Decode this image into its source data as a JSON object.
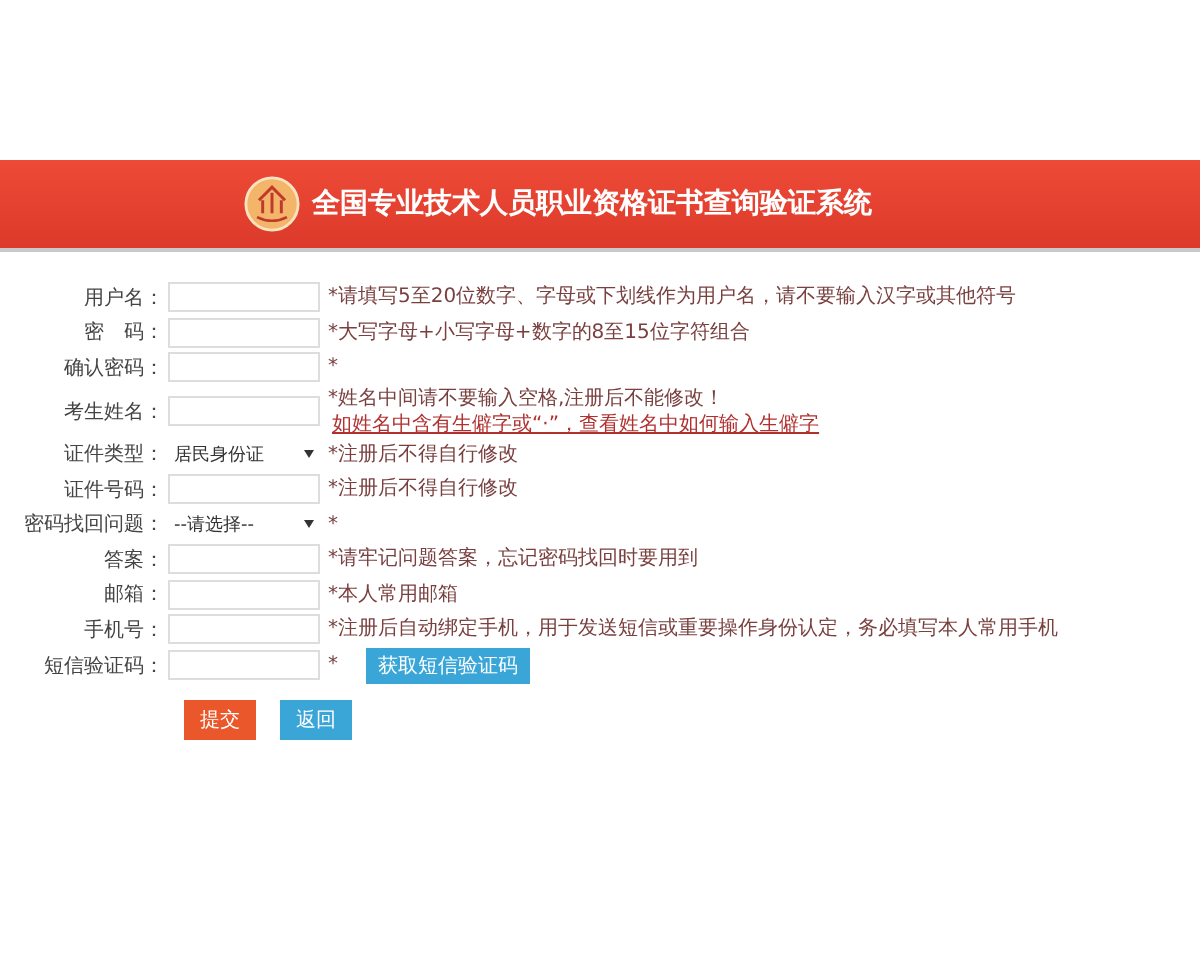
{
  "header": {
    "title": "全国专业技术人员职业资格证书查询验证系统"
  },
  "form": {
    "rows": [
      {
        "label": "用户名：",
        "kind": "input",
        "hint": "*请填写5至20位数字、字母或下划线作为用户名，请不要输入汉字或其他符号"
      },
      {
        "label": "密　码：",
        "kind": "input",
        "hint": "*大写字母+小写字母+数字的8至15位字符组合"
      },
      {
        "label": "确认密码：",
        "kind": "input",
        "hint": "*"
      },
      {
        "label": "考生姓名：",
        "kind": "input",
        "hint": "*姓名中间请不要输入空格,注册后不能修改！",
        "link": "如姓名中含有生僻字或“·”，查看姓名中如何输入生僻字"
      },
      {
        "label": "证件类型：",
        "kind": "select",
        "value": "居民身份证",
        "hint": "*注册后不得自行修改"
      },
      {
        "label": "证件号码：",
        "kind": "input",
        "hint": "*注册后不得自行修改"
      },
      {
        "label": "密码找回问题：",
        "kind": "select",
        "value": "--请选择--",
        "hint": "*"
      },
      {
        "label": "答案：",
        "kind": "input",
        "hint": "*请牢记问题答案，忘记密码找回时要用到"
      },
      {
        "label": "邮箱：",
        "kind": "input",
        "hint": "*本人常用邮箱"
      },
      {
        "label": "手机号：",
        "kind": "input",
        "hint": "*注册后自动绑定手机，用于发送短信或重要操作身份认定，务必填写本人常用手机"
      },
      {
        "label": "短信验证码：",
        "kind": "input",
        "hint": "*",
        "button": "获取短信验证码"
      }
    ]
  },
  "actions": [
    {
      "label": "提交",
      "kind": "submit"
    },
    {
      "label": "返回",
      "kind": "back"
    }
  ]
}
